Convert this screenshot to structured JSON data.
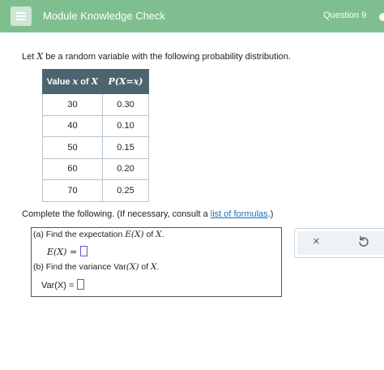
{
  "header": {
    "menu_icon": "hamburger-menu-icon",
    "module_title": "Module Knowledge Check",
    "question_label": "Question 9"
  },
  "prompt": {
    "before": "Let ",
    "variable": "X",
    "after": " be a random variable with the following probability distribution."
  },
  "table": {
    "header_value_prefix": "Value ",
    "header_value_math": "x",
    "header_value_mid": " of ",
    "header_value_var": "X",
    "header_prob": "P(X=x)",
    "rows": [
      {
        "x": "30",
        "p": "0.30"
      },
      {
        "x": "40",
        "p": "0.10"
      },
      {
        "x": "50",
        "p": "0.15"
      },
      {
        "x": "60",
        "p": "0.20"
      },
      {
        "x": "70",
        "p": "0.25"
      }
    ]
  },
  "complete": {
    "before": "Complete the following. (If necessary, consult a ",
    "link": "list of formulas",
    "after": ".)"
  },
  "parts": {
    "a_text": "(a) Find the expectation ",
    "a_math": "E(X)",
    "a_of": " of ",
    "a_var": "X",
    "a_end": ".",
    "a_answer_label": "E(X) =",
    "b_text": "(b) Find the variance Var",
    "b_math": "(X)",
    "b_of": " of ",
    "b_var": "X",
    "b_end": ".",
    "b_answer_label": "Var(X) ="
  },
  "actions": {
    "clear": "×",
    "clear_icon": "close-icon",
    "undo_icon": "undo-icon"
  }
}
